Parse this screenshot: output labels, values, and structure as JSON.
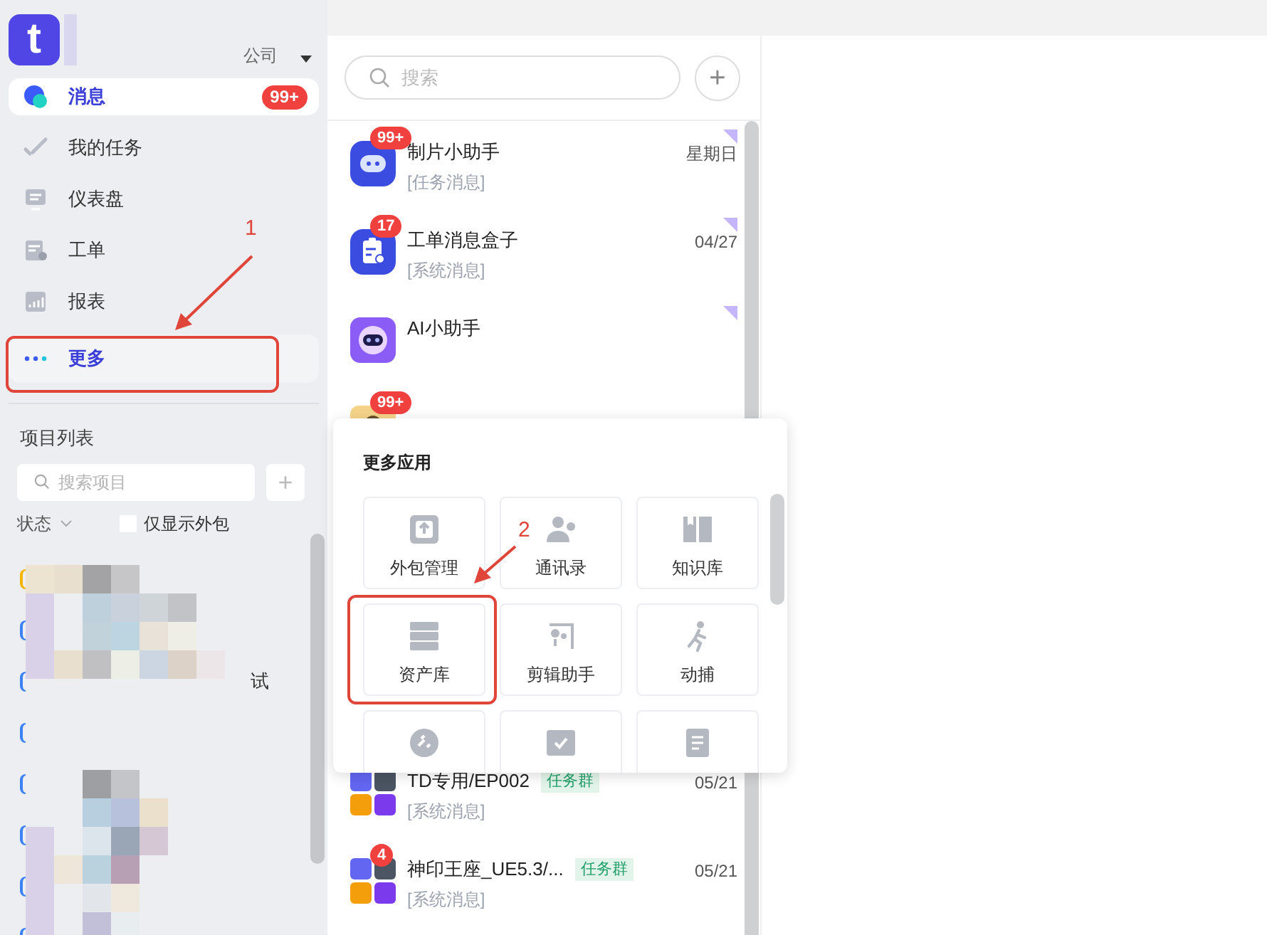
{
  "header": {
    "logo_letter": "t",
    "company": "公司"
  },
  "nav": [
    {
      "label": "消息",
      "selected": true,
      "open": false,
      "badge": "99+"
    },
    {
      "label": "我的任务",
      "selected": false,
      "open": false
    },
    {
      "label": "仪表盘",
      "selected": false,
      "open": false
    },
    {
      "label": "工单",
      "selected": false,
      "open": false
    },
    {
      "label": "报表",
      "selected": false,
      "open": false
    },
    {
      "label": "更多",
      "selected": false,
      "open": true
    }
  ],
  "projects": {
    "title": "项目列表",
    "search": {
      "placeholder": "搜索项目"
    },
    "add": "+",
    "filter": "状态",
    "only_outsourced": {
      "label": "仅显示外包",
      "checked": false
    },
    "items": [
      {
        "color": "#f5b400"
      },
      {
        "color": "#3b82f6"
      },
      {
        "color": "#3b82f6",
        "text": "试"
      },
      {
        "color": "#3b82f6"
      },
      {
        "color": "#3b82f6"
      },
      {
        "color": "#3b82f6"
      },
      {
        "color": "#3b82f6"
      },
      {
        "color": "#3b82f6"
      }
    ]
  },
  "messages": {
    "search": {
      "placeholder": "搜索"
    },
    "add": "+",
    "items": [
      {
        "title": "制片小助手",
        "subtitle": "[任务消息]",
        "time": "星期日",
        "badge": "99+",
        "pinned": true
      },
      {
        "title": "工单消息盒子",
        "subtitle": "[系统消息]",
        "time": "04/27",
        "badge": "17",
        "pinned": true
      },
      {
        "title": "AI小助手",
        "pinned": true
      },
      {
        "badge": "99+",
        "pinned": false
      },
      {
        "title": "TD专用/EP002",
        "subtitle": "[系统消息]",
        "time": "05/21",
        "tag": "任务群"
      },
      {
        "title": "神印王座_UE5.3/...",
        "subtitle": "[系统消息]",
        "time": "05/21",
        "tag": "任务群",
        "badge": "4",
        "pinned": false
      }
    ]
  },
  "more_apps": {
    "title": "更多应用",
    "apps": [
      {
        "kind": "labeled",
        "label": "外包管理"
      },
      {
        "kind": "labeled",
        "label": "通讯录"
      },
      {
        "kind": "labeled",
        "label": "知识库"
      },
      {
        "kind": "labeled",
        "label": "资产库"
      },
      {
        "kind": "labeled",
        "label": "剪辑助手"
      },
      {
        "kind": "labeled",
        "label": "动捕"
      },
      {
        "kind": "icon_only"
      },
      {
        "kind": "icon_only"
      },
      {
        "kind": "icon_only"
      }
    ]
  },
  "annotations": [
    {
      "label": "1"
    },
    {
      "label": "2"
    }
  ]
}
